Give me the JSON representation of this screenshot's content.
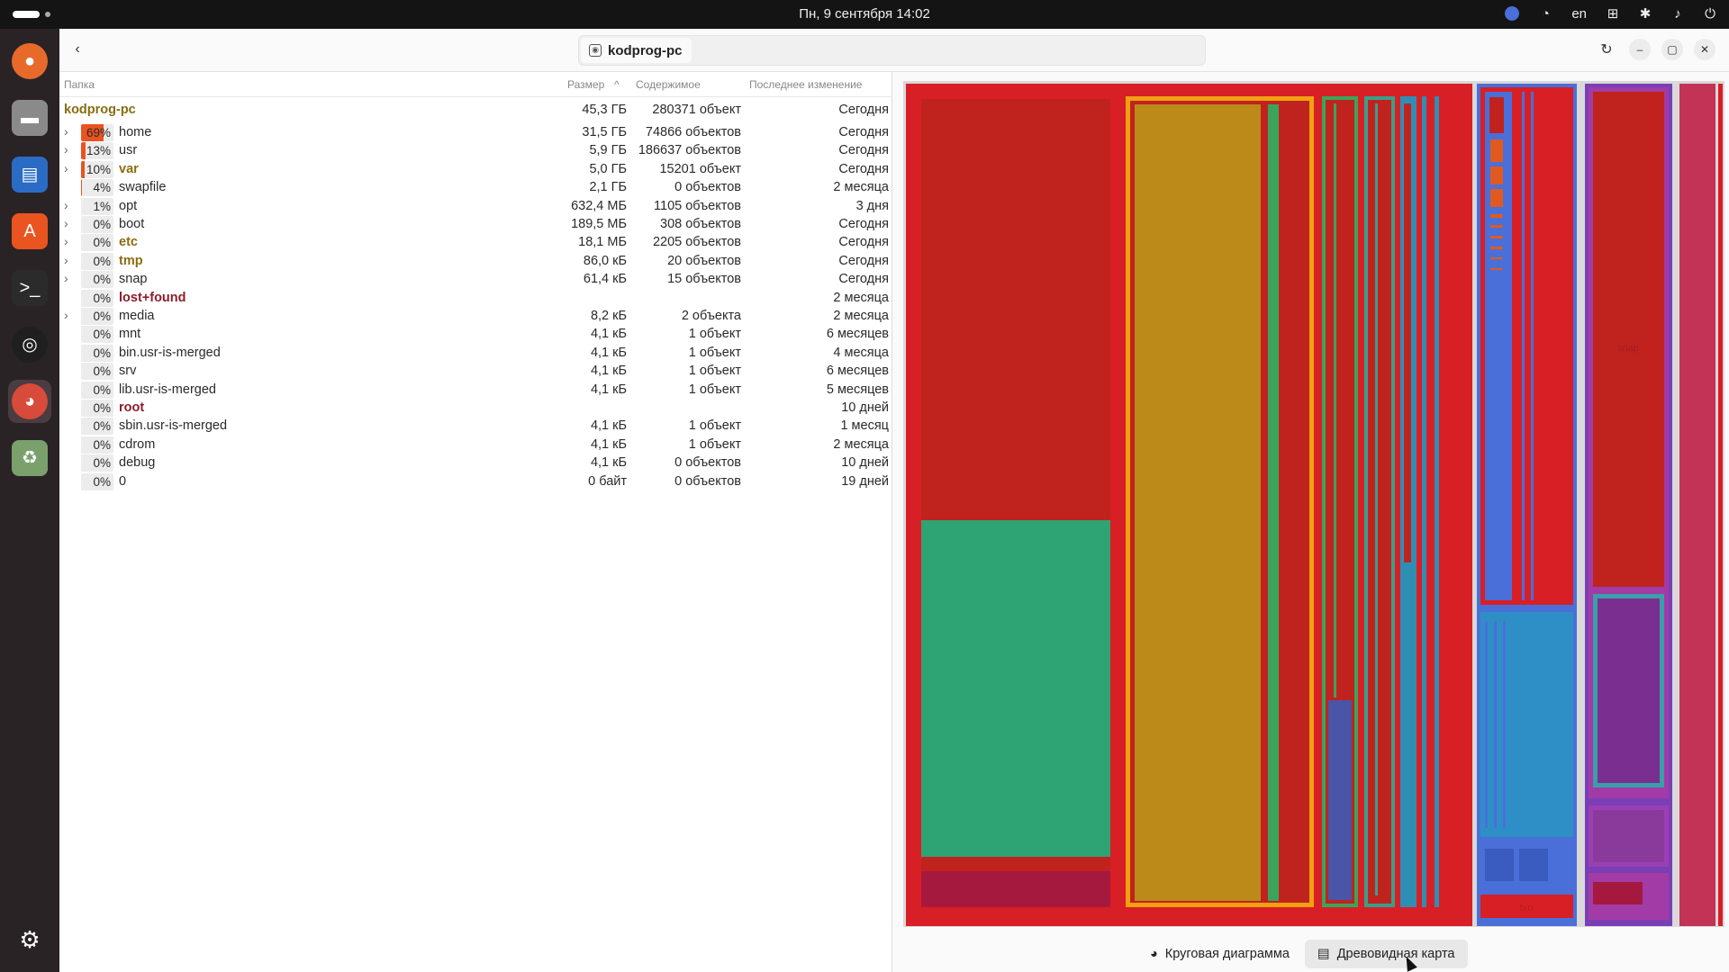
{
  "topbar": {
    "clock": "Пн, 9 сентября  14:02",
    "lang": "en"
  },
  "dock": {
    "apps": [
      {
        "name": "firefox-icon",
        "color": "#e86a2b"
      },
      {
        "name": "files-icon",
        "color": "#8a8a8a"
      },
      {
        "name": "writer-icon",
        "color": "#2a6cc4"
      },
      {
        "name": "app-center-icon",
        "color": "#e95420"
      },
      {
        "name": "terminal-icon",
        "color": "#2b2b2b"
      },
      {
        "name": "obs-icon",
        "color": "#1f1f1f"
      },
      {
        "name": "disk-usage-icon",
        "color": "#d84a3a"
      },
      {
        "name": "trash-icon",
        "color": "#7aa06c"
      }
    ]
  },
  "window": {
    "location": "kodprog-pc",
    "columns": {
      "folder": "Папка",
      "size": "Размер",
      "contents": "Содержимое",
      "modified": "Последнее изменение"
    },
    "root": {
      "name": "kodprog-pc",
      "size": "45,3 ГБ",
      "contents": "280371 объект",
      "modified": "Сегодня"
    },
    "rows": [
      {
        "expander": "›",
        "pct": "69%",
        "fill": 0.69,
        "name": "home",
        "size": "31,5 ГБ",
        "contents": "74866 объектов",
        "modified": "Сегодня",
        "style": ""
      },
      {
        "expander": "›",
        "pct": "13%",
        "fill": 0.13,
        "name": "usr",
        "size": "5,9 ГБ",
        "contents": "186637 объектов",
        "modified": "Сегодня",
        "style": ""
      },
      {
        "expander": "›",
        "pct": "10%",
        "fill": 0.1,
        "name": "var",
        "size": "5,0 ГБ",
        "contents": "15201 объект",
        "modified": "Сегодня",
        "style": "bold-olive"
      },
      {
        "expander": "",
        "pct": "4%",
        "fill": 0.04,
        "name": "swapfile",
        "size": "2,1 ГБ",
        "contents": "0 объектов",
        "modified": "2 месяца",
        "style": ""
      },
      {
        "expander": "›",
        "pct": "1%",
        "fill": 0.01,
        "name": "opt",
        "size": "632,4 МБ",
        "contents": "1105 объектов",
        "modified": "3 дня",
        "style": ""
      },
      {
        "expander": "›",
        "pct": "0%",
        "fill": 0,
        "name": "boot",
        "size": "189,5 МБ",
        "contents": "308 объектов",
        "modified": "Сегодня",
        "style": ""
      },
      {
        "expander": "›",
        "pct": "0%",
        "fill": 0,
        "name": "etc",
        "size": "18,1 МБ",
        "contents": "2205 объектов",
        "modified": "Сегодня",
        "style": "bold-olive"
      },
      {
        "expander": "›",
        "pct": "0%",
        "fill": 0,
        "name": "tmp",
        "size": "86,0 кБ",
        "contents": "20 объектов",
        "modified": "Сегодня",
        "style": "bold-olive"
      },
      {
        "expander": "›",
        "pct": "0%",
        "fill": 0,
        "name": "snap",
        "size": "61,4 кБ",
        "contents": "15 объектов",
        "modified": "Сегодня",
        "style": ""
      },
      {
        "expander": "",
        "pct": "0%",
        "fill": 0,
        "name": "lost+found",
        "size": "",
        "contents": "",
        "modified": "2 месяца",
        "style": "bold-red"
      },
      {
        "expander": "›",
        "pct": "0%",
        "fill": 0,
        "name": "media",
        "size": "8,2 кБ",
        "contents": "2 объекта",
        "modified": "2 месяца",
        "style": ""
      },
      {
        "expander": "",
        "pct": "0%",
        "fill": 0,
        "name": "mnt",
        "size": "4,1 кБ",
        "contents": "1 объект",
        "modified": "6 месяцев",
        "style": ""
      },
      {
        "expander": "",
        "pct": "0%",
        "fill": 0,
        "name": "bin.usr-is-merged",
        "size": "4,1 кБ",
        "contents": "1 объект",
        "modified": "4 месяца",
        "style": ""
      },
      {
        "expander": "",
        "pct": "0%",
        "fill": 0,
        "name": "srv",
        "size": "4,1 кБ",
        "contents": "1 объект",
        "modified": "6 месяцев",
        "style": ""
      },
      {
        "expander": "",
        "pct": "0%",
        "fill": 0,
        "name": "lib.usr-is-merged",
        "size": "4,1 кБ",
        "contents": "1 объект",
        "modified": "5 месяцев",
        "style": ""
      },
      {
        "expander": "",
        "pct": "0%",
        "fill": 0,
        "name": "root",
        "size": "",
        "contents": "",
        "modified": "10 дней",
        "style": "bold-red"
      },
      {
        "expander": "",
        "pct": "0%",
        "fill": 0,
        "name": "sbin.usr-is-merged",
        "size": "4,1 кБ",
        "contents": "1 объект",
        "modified": "1 месяц",
        "style": ""
      },
      {
        "expander": "",
        "pct": "0%",
        "fill": 0,
        "name": "cdrom",
        "size": "4,1 кБ",
        "contents": "1 объект",
        "modified": "2 месяца",
        "style": ""
      },
      {
        "expander": "",
        "pct": "0%",
        "fill": 0,
        "name": "debug",
        "size": "4,1 кБ",
        "contents": "0 объектов",
        "modified": "10 дней",
        "style": ""
      },
      {
        "expander": "",
        "pct": "0%",
        "fill": 0,
        "name": "0",
        "size": "0 байт",
        "contents": "0 объектов",
        "modified": "19 дней",
        "style": ""
      }
    ],
    "view_switch": {
      "pie": "Круговая диаграмма",
      "treemap": "Древовидная карта"
    },
    "treemap_labels": {
      "snap": "snap",
      "bin": "bin"
    },
    "fill_color": "#e95420"
  }
}
